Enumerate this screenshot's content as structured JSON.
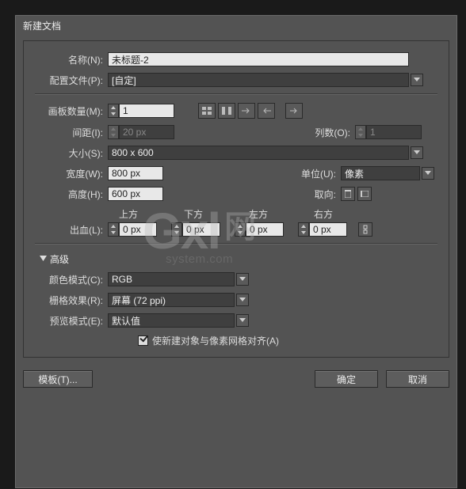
{
  "window": {
    "title": "新建文档"
  },
  "name": {
    "label": "名称(N):",
    "value": "未标题-2"
  },
  "profile": {
    "label": "配置文件(P):",
    "value": "[自定]"
  },
  "artboards": {
    "count": {
      "label": "画板数量(M):",
      "value": "1"
    },
    "spacing": {
      "label": "间距(I):",
      "value": "20 px"
    },
    "columns": {
      "label": "列数(O):",
      "value": "1"
    }
  },
  "size": {
    "label": "大小(S):",
    "value": "800 x 600"
  },
  "width": {
    "label": "宽度(W):",
    "value": "800 px"
  },
  "height": {
    "label": "高度(H):",
    "value": "600 px"
  },
  "units": {
    "label": "单位(U):",
    "value": "像素"
  },
  "orientation": {
    "label": "取向:"
  },
  "bleed": {
    "label": "出血(L):",
    "top": {
      "label": "上方",
      "value": "0 px"
    },
    "bottom": {
      "label": "下方",
      "value": "0 px"
    },
    "left": {
      "label": "左方",
      "value": "0 px"
    },
    "right": {
      "label": "右方",
      "value": "0 px"
    }
  },
  "advanced": {
    "label": "高级"
  },
  "colormode": {
    "label": "颜色模式(C):",
    "value": "RGB"
  },
  "raster": {
    "label": "栅格效果(R):",
    "value": "屏幕 (72 ppi)"
  },
  "preview": {
    "label": "预览模式(E):",
    "value": "默认值"
  },
  "align_checkbox": {
    "label": "使新建对象与像素网格对齐(A)"
  },
  "footer": {
    "template": "模板(T)...",
    "ok": "确定",
    "cancel": "取消"
  },
  "watermark": {
    "logo": "Gxl",
    "cn": "网",
    "url": "system.com"
  }
}
